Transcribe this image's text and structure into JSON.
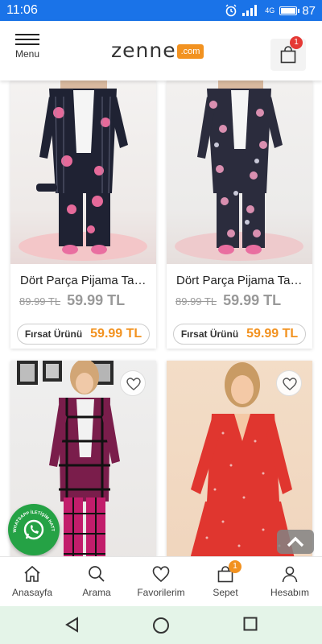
{
  "status_bar": {
    "time": "11:06",
    "network": "4G",
    "battery": "87",
    "battery_level": 0.87,
    "icons": [
      "alarm-icon",
      "signal-icon",
      "battery-icon"
    ]
  },
  "header": {
    "menu_label": "Menu",
    "logo_word": "zenne",
    "logo_suffix": ".com",
    "cart_count": "1",
    "brand_color": "#f29220"
  },
  "products": [
    {
      "name": "Dört Parça Pijama Takımı",
      "old_price": "89.99 TL",
      "price": "59.99 TL",
      "deal_label": "Fırsat Ürünü",
      "deal_price": "59.99 TL"
    },
    {
      "name": "Dört Parça Pijama Takımı",
      "old_price": "89.99 TL",
      "price": "59.99 TL",
      "deal_label": "Fırsat Ürünü",
      "deal_price": "59.99 TL"
    },
    {
      "name": "",
      "favorite_icon": "heart-icon"
    },
    {
      "name": "",
      "favorite_icon": "heart-icon"
    }
  ],
  "whatsapp": {
    "text": "WHATSAPP İLETİŞİM HATTI"
  },
  "bottom_nav": {
    "items": [
      {
        "label": "Anasayfa",
        "icon": "home-icon"
      },
      {
        "label": "Arama",
        "icon": "search-icon"
      },
      {
        "label": "Favorilerim",
        "icon": "heart-icon"
      },
      {
        "label": "Sepet",
        "icon": "bag-icon",
        "badge": "1"
      },
      {
        "label": "Hesabım",
        "icon": "user-icon"
      }
    ]
  },
  "system_nav": {
    "icons": [
      "back-icon",
      "home-circle-icon",
      "recents-icon"
    ]
  },
  "colors": {
    "status_bar": "#1a73e8",
    "accent": "#f29220",
    "badge_red": "#e53935",
    "whatsapp_green": "#25a245"
  }
}
